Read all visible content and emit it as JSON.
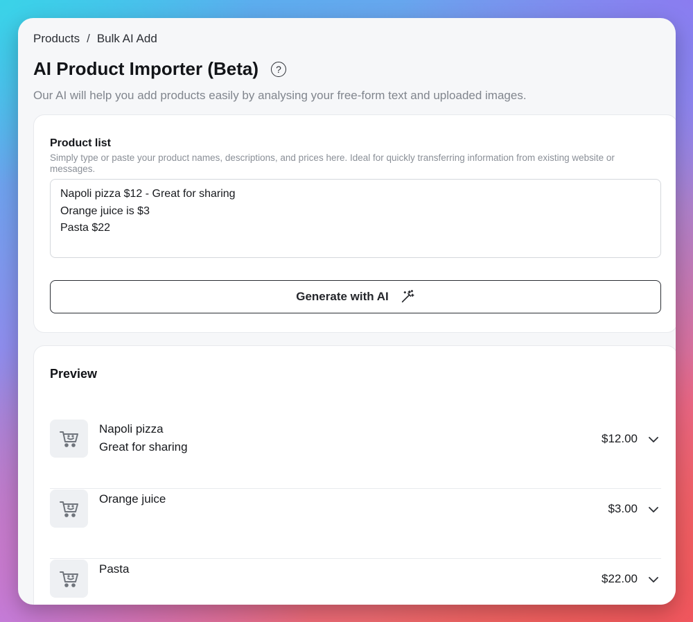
{
  "breadcrumb": {
    "items": [
      "Products",
      "Bulk AI Add"
    ],
    "separator": "/"
  },
  "page": {
    "title": "AI Product Importer (Beta)",
    "subtitle": "Our AI will help you add products easily by analysing your free-form text and uploaded images.",
    "help_icon": "question-circle-icon"
  },
  "input_card": {
    "label": "Product list",
    "help": "Simply type or paste your product names, descriptions, and prices here. Ideal for quickly transferring information from existing website or messages.",
    "value": "Napoli pizza $12 - Great for sharing\nOrange juice is $3\nPasta $22",
    "generate_label": "Generate with AI",
    "generate_icon": "magic-wand-icon"
  },
  "preview": {
    "title": "Preview",
    "items": [
      {
        "name": "Napoli pizza",
        "description": "Great for sharing",
        "price": "$12.00",
        "icon": "cart-smile-icon"
      },
      {
        "name": "Orange juice",
        "description": "",
        "price": "$3.00",
        "icon": "cart-smile-icon"
      },
      {
        "name": "Pasta",
        "description": "",
        "price": "$22.00",
        "icon": "cart-smile-icon"
      }
    ]
  },
  "colors": {
    "text": "#17191d",
    "muted": "#80858d",
    "card": "#ffffff",
    "window": "#f6f7f9"
  }
}
